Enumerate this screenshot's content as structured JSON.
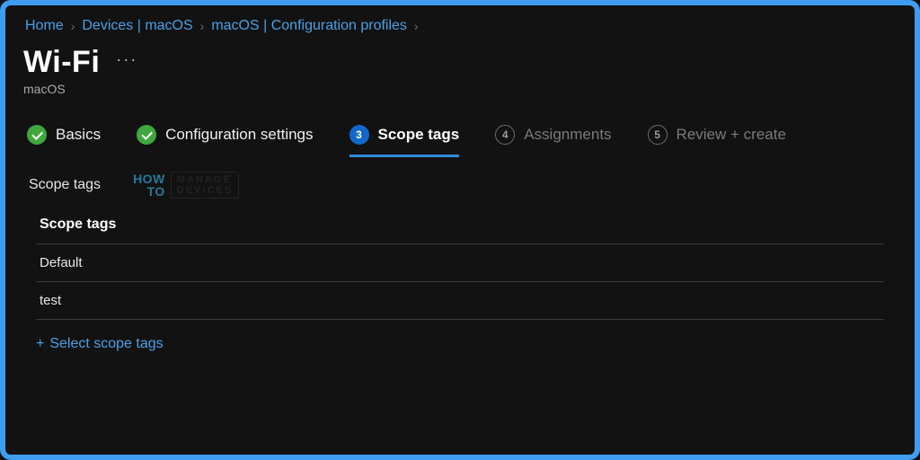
{
  "breadcrumbs": {
    "items": [
      "Home",
      "Devices | macOS",
      "macOS | Configuration profiles"
    ]
  },
  "page": {
    "title": "Wi-Fi",
    "subtitle": "macOS",
    "more": "···"
  },
  "steps": {
    "s1": {
      "label": "Basics"
    },
    "s2": {
      "label": "Configuration settings"
    },
    "s3": {
      "num": "3",
      "label": "Scope tags"
    },
    "s4": {
      "num": "4",
      "label": "Assignments"
    },
    "s5": {
      "num": "5",
      "label": "Review + create"
    }
  },
  "section": {
    "heading": "Scope tags"
  },
  "watermark": {
    "l1": "HOW",
    "l2": "TO",
    "r1": "MANAGE",
    "r2": "DEVICES"
  },
  "table": {
    "header": "Scope tags",
    "rows": [
      "Default",
      "test"
    ]
  },
  "actions": {
    "selectScopeTags": "Select scope tags",
    "plus": "+"
  }
}
